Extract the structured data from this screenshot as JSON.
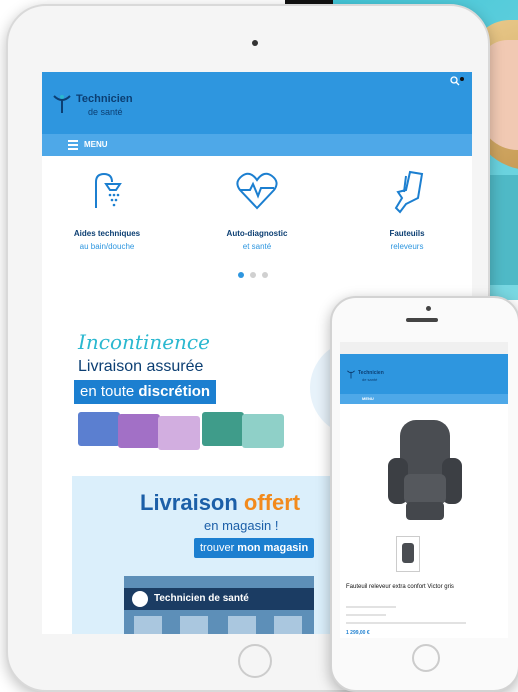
{
  "tablet": {
    "logo": {
      "name": "Technicien",
      "sub": "de santé"
    },
    "menu_label": "MENU",
    "categories": [
      {
        "line1": "Aides techniques",
        "line2": "au bain/douche",
        "icon": "shower-icon"
      },
      {
        "line1": "Auto-diagnostic",
        "line2": "et santé",
        "icon": "heart-pulse-icon"
      },
      {
        "line1": "Fauteuils",
        "line2": "releveurs",
        "icon": "armchair-icon"
      }
    ],
    "promo_incontinence": {
      "title": "Incontinence",
      "line2": "Livraison assurée",
      "line3_pre": "en toute ",
      "line3_bold": "discrétion"
    },
    "banner": {
      "title_pre": "Livraison ",
      "title_highlight": "offert",
      "subtitle": "en magasin !",
      "button_pre": "trouver ",
      "button_bold": "mon magasin",
      "store_sign": "Technicien de santé"
    }
  },
  "phone": {
    "logo": {
      "name": "Technicien",
      "sub": "de santé"
    },
    "menu_label": "MENU",
    "product_name": "Fauteuil releveur extra confort Victor gris",
    "price": "1 299,00 €"
  },
  "colors": {
    "primary": "#2e96df",
    "navy": "#0c3f73",
    "orange": "#f28a1c",
    "teal": "#2bb8d0"
  }
}
